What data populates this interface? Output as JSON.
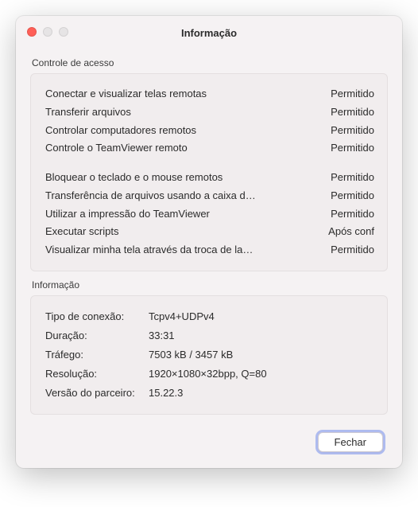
{
  "window": {
    "title": "Informação"
  },
  "access": {
    "title": "Controle de acesso",
    "group1": [
      {
        "label": "Conectar e visualizar telas remotas",
        "status": "Permitido"
      },
      {
        "label": "Transferir arquivos",
        "status": "Permitido"
      },
      {
        "label": "Controlar computadores remotos",
        "status": "Permitido"
      },
      {
        "label": "Controle o TeamViewer remoto",
        "status": "Permitido"
      }
    ],
    "group2": [
      {
        "label": "Bloquear o teclado e o mouse remotos",
        "status": "Permitido"
      },
      {
        "label": "Transferência de arquivos usando a caixa d…",
        "status": "Permitido"
      },
      {
        "label": "Utilizar a impressão do TeamViewer",
        "status": "Permitido"
      },
      {
        "label": "Executar scripts",
        "status": "Após conf"
      },
      {
        "label": "Visualizar minha tela através da troca de la…",
        "status": "Permitido"
      }
    ]
  },
  "info": {
    "title": "Informação",
    "rows": [
      {
        "label": "Tipo de conexão:",
        "value": "Tcpv4+UDPv4"
      },
      {
        "label": "Duração:",
        "value": "33:31"
      },
      {
        "label": "Tráfego:",
        "value": "7503 kB / 3457 kB"
      },
      {
        "label": "Resolução:",
        "value": "1920×1080×32bpp, Q=80"
      },
      {
        "label": "Versão do parceiro:",
        "value": "15.22.3"
      }
    ]
  },
  "footer": {
    "close_label": "Fechar"
  }
}
